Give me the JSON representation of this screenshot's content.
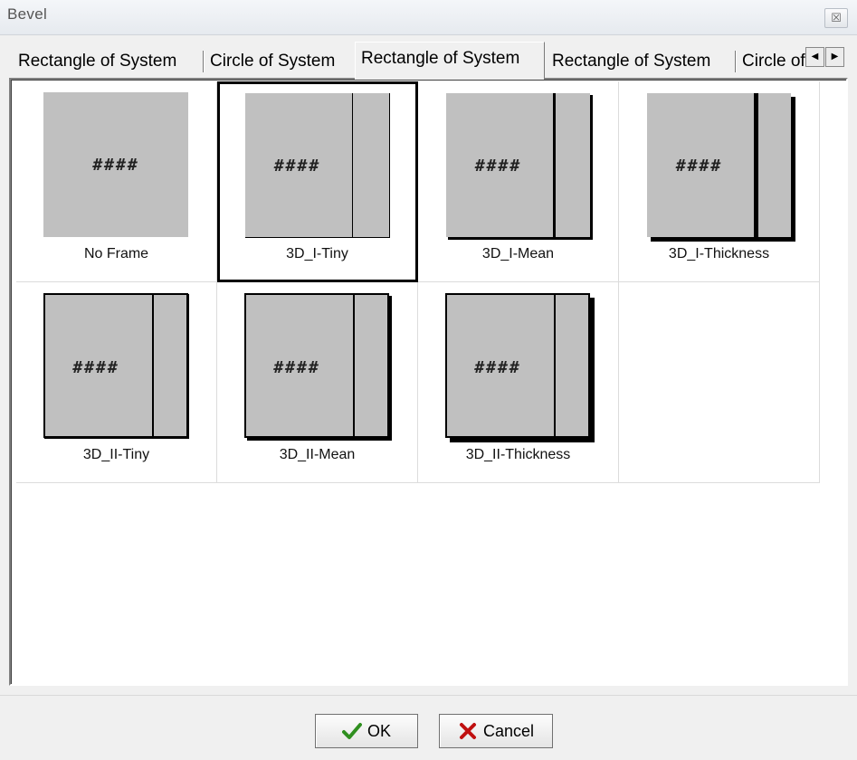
{
  "window": {
    "title": "Bevel",
    "close_glyph": "☒"
  },
  "tabs": [
    {
      "label": "Rectangle of System",
      "active": false
    },
    {
      "label": "Circle of System",
      "active": false
    },
    {
      "label": "Rectangle of System",
      "active": true
    },
    {
      "label": "Rectangle of System",
      "active": false
    },
    {
      "label": "Circle of",
      "active": false
    }
  ],
  "tab_scroll": {
    "left_glyph": "◀",
    "right_glyph": "▶"
  },
  "options": [
    {
      "label": "No Frame",
      "placeholder": "####",
      "selected": false
    },
    {
      "label": "3D_I-Tiny",
      "placeholder": "####",
      "selected": true
    },
    {
      "label": "3D_I-Mean",
      "placeholder": "####",
      "selected": false
    },
    {
      "label": "3D_I-Thickness",
      "placeholder": "####",
      "selected": false
    },
    {
      "label": "3D_II-Tiny",
      "placeholder": "####",
      "selected": false
    },
    {
      "label": "3D_II-Mean",
      "placeholder": "####",
      "selected": false
    },
    {
      "label": "3D_II-Thickness",
      "placeholder": "####",
      "selected": false
    }
  ],
  "buttons": {
    "ok_label": "OK",
    "cancel_label": "Cancel"
  },
  "colors": {
    "preview_fill": "#c0c0c0",
    "ok_check": "#2f8f1f",
    "cancel_x": "#c01010"
  },
  "icons": {
    "ok": "check-icon",
    "cancel": "x-icon",
    "close": "close-icon"
  }
}
